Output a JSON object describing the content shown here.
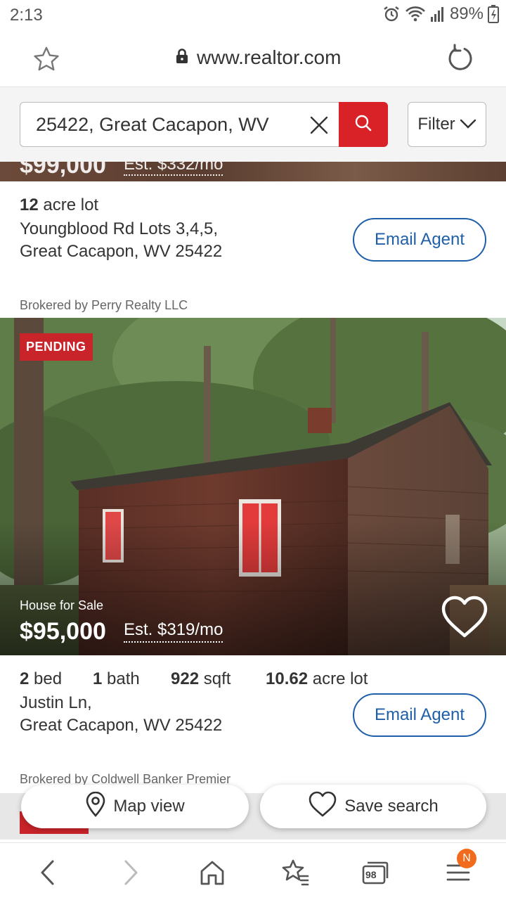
{
  "status_bar": {
    "time": "2:13",
    "battery": "89%"
  },
  "browser": {
    "url": "www.realtor.com",
    "tab_count": "98",
    "menu_badge": "N"
  },
  "search": {
    "value": "25422, Great Cacapon, WV",
    "filter_label": "Filter"
  },
  "listings": [
    {
      "features": [
        {
          "value": "12",
          "label": "acre lot"
        }
      ],
      "address_line1": "Youngblood Rd Lots 3,4,5,",
      "address_line2": "Great Cacapon, WV 25422",
      "email_label": "Email Agent",
      "broker": "Brokered by Perry Realty LLC"
    },
    {
      "badge": "PENDING",
      "type": "House for Sale",
      "price": "$95,000",
      "estimate": "Est. $319/mo",
      "features": [
        {
          "value": "2",
          "label": "bed"
        },
        {
          "value": "1",
          "label": "bath"
        },
        {
          "value": "922",
          "label": "sqft"
        },
        {
          "value": "10.62",
          "label": "acre lot"
        }
      ],
      "address_line1": "Justin Ln,",
      "address_line2": "Great Cacapon, WV 25422",
      "email_label": "Email Agent",
      "broker": "Brokered by Coldwell Banker Premier"
    }
  ],
  "floating": {
    "map_label": "Map view",
    "save_label": "Save search"
  },
  "colors": {
    "brand_red": "#d92228",
    "link_blue": "#1f5fa9",
    "badge_red": "#c9242a",
    "notif_orange": "#f26b1d"
  }
}
